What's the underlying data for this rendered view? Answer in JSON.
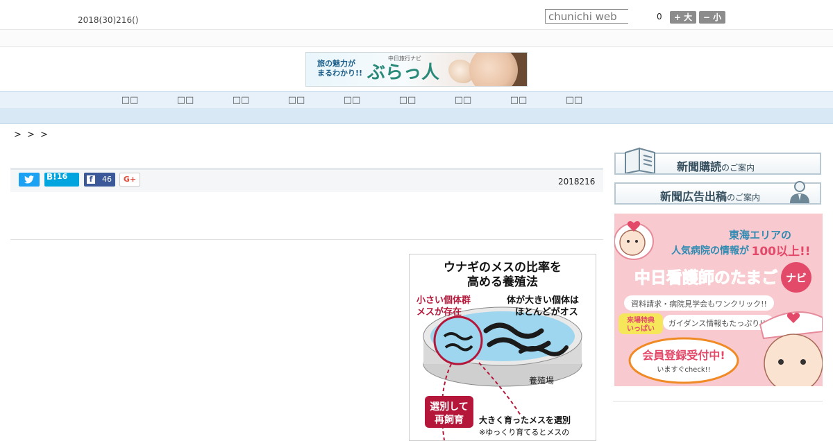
{
  "header": {
    "date": "2018(30)216()",
    "search_placeholder": "chunichi web",
    "font_size_value": "0",
    "font_larger_label": "+ 大",
    "font_smaller_label": "− 小"
  },
  "top_ad": {
    "tagline_line1": "旅の魅力が",
    "tagline_line2": "まるわかり!!",
    "brand_small": "中日旅行ナビ",
    "brand": "ぶらっ人"
  },
  "nav": {
    "items": [
      "□□",
      "□□",
      "□□",
      "□□",
      "□□",
      "□□",
      "□□",
      "□□",
      "□□"
    ]
  },
  "breadcrumb": "> > >",
  "share": {
    "twitter_glyph": "🐦",
    "hatena_label": "B!",
    "hatena_count": "16",
    "facebook_glyph": "f",
    "facebook_count": "46",
    "gplus_label": "G+",
    "date": "2018216"
  },
  "figure": {
    "title_line1": "ウナギのメスの比率を",
    "title_line2": "高める養殖法",
    "label_small_group_1": "小さい個体群",
    "label_small_group_2": "メスが存在",
    "label_big_1": "体が大きい個体は",
    "label_big_2": "ほとんどがオス",
    "label_pond": "養殖場",
    "label_select_1": "選別して",
    "label_select_2": "再飼育",
    "label_grown": "大きく育ったメスを選別",
    "label_note": "※ゆっくり育てるとメスの"
  },
  "sidebar": {
    "subscribe_main": "新聞購読",
    "subscribe_sub": "のご案内",
    "advertise_main": "新聞広告出稿",
    "advertise_sub": "のご案内",
    "ad": {
      "line1": "東海エリアの",
      "line2a": "人気病院の情報が",
      "line2b": "100以上!!",
      "brand": "中日看護師のたまご",
      "brand_badge": "ナビ",
      "feature1": "資料請求・病院見学会もワンクリック!!",
      "feature2_badge_1": "来場特典",
      "feature2_badge_2": "いっぱい",
      "feature2": "ガイダンス情報もたっぷり!!",
      "cta": "会員登録受付中!",
      "cta_sub": "いますぐcheck!!"
    }
  },
  "colors": {
    "nav_bg": "#e8f1f9",
    "subnav_bg": "#d8e8f5",
    "twitter": "#1da1f2",
    "hatena": "#00a4de",
    "facebook": "#3b5998",
    "ad_pink": "#f8c9cf",
    "ad_orange": "#f08a24"
  }
}
